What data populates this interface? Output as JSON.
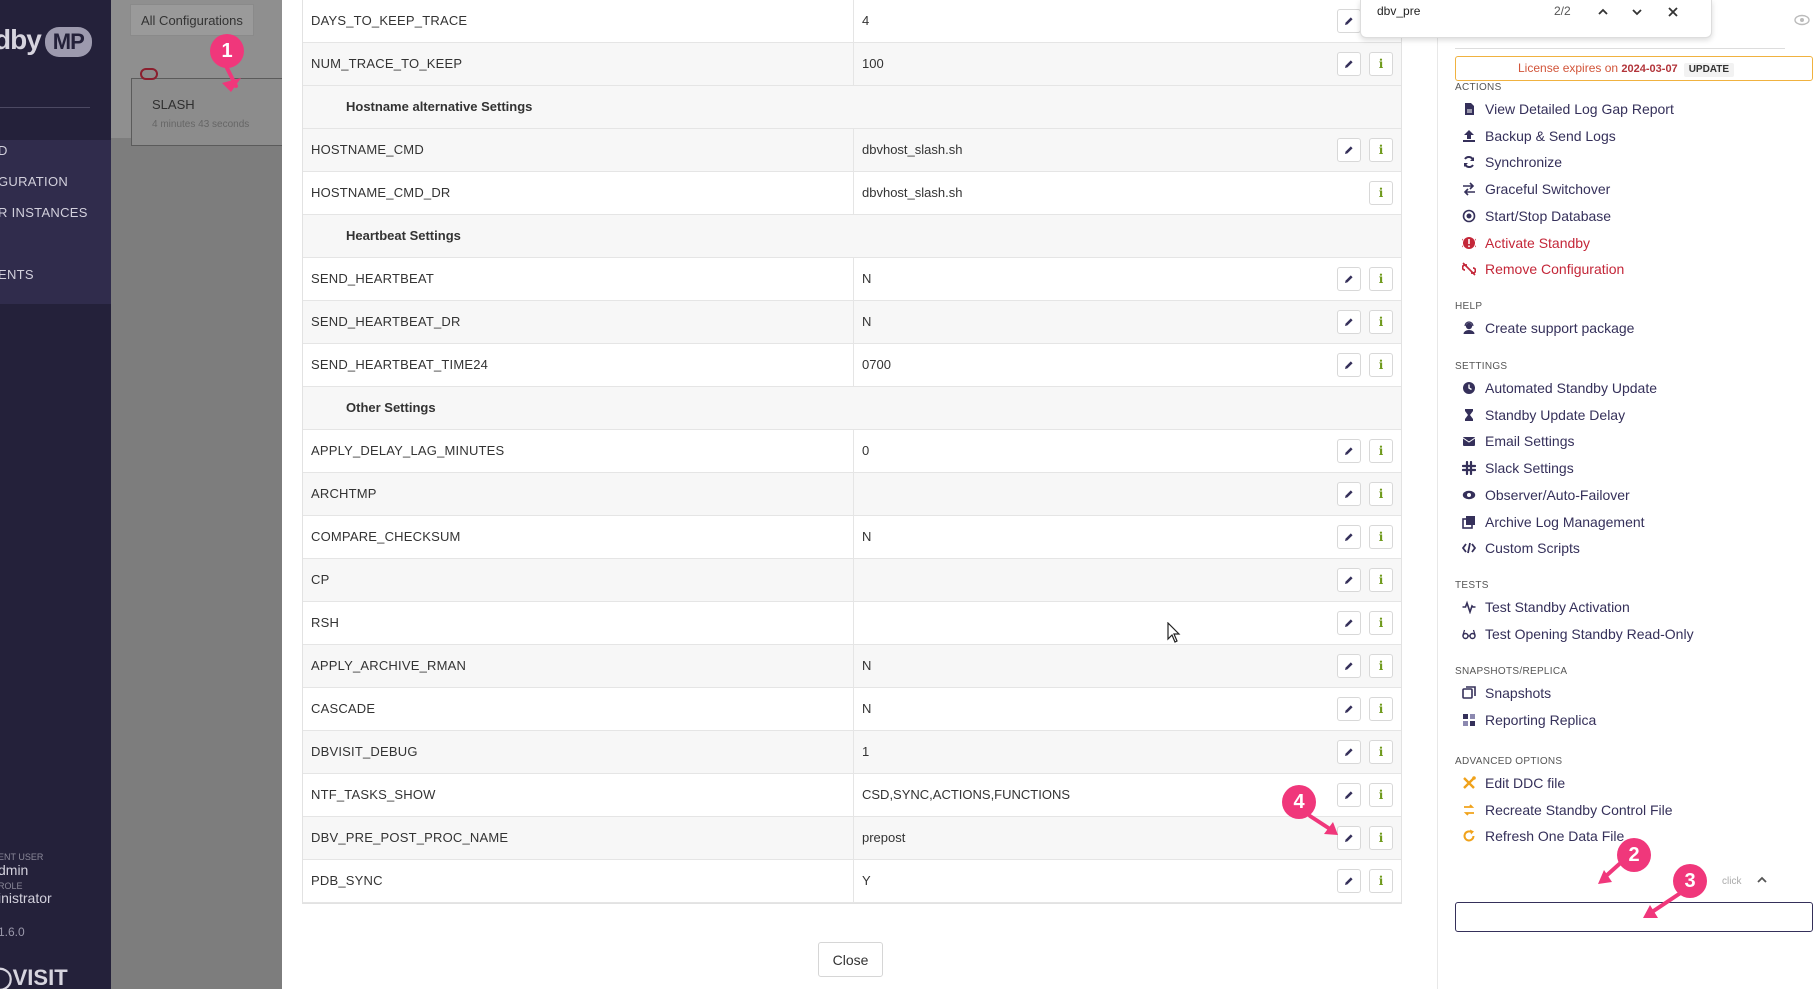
{
  "sidebar": {
    "logo_text": "dby",
    "logo_badge": "MP",
    "nav_items": [
      "D",
      "GURATION",
      "R INSTANCES",
      "ENTS"
    ],
    "user_label": "ENT USER",
    "user_name": "dmin",
    "role_label": "ROLE",
    "role_name": "inistrator",
    "version": "1.6.0",
    "brand": "VISIT"
  },
  "background": {
    "tab_label": "All Configurations",
    "card_name": "SLASH",
    "card_time": "4 minutes 43 seconds"
  },
  "find_bar": {
    "query": "dbv_pre",
    "count": "2/2"
  },
  "ddc_table": {
    "rows": [
      {
        "type": "param",
        "key": "DAYS_TO_KEEP_TRACE",
        "value": "4",
        "editable": true
      },
      {
        "type": "param",
        "key": "NUM_TRACE_TO_KEEP",
        "value": "100",
        "editable": true
      },
      {
        "type": "section",
        "title": "Hostname alternative Settings"
      },
      {
        "type": "param",
        "key": "HOSTNAME_CMD",
        "value": "dbvhost_slash.sh",
        "editable": true
      },
      {
        "type": "param",
        "key": "HOSTNAME_CMD_DR",
        "value": "dbvhost_slash.sh",
        "editable": false
      },
      {
        "type": "section",
        "title": "Heartbeat Settings"
      },
      {
        "type": "param",
        "key": "SEND_HEARTBEAT",
        "value": "N",
        "editable": true
      },
      {
        "type": "param",
        "key": "SEND_HEARTBEAT_DR",
        "value": "N",
        "editable": true
      },
      {
        "type": "param",
        "key": "SEND_HEARTBEAT_TIME24",
        "value": "0700",
        "editable": true
      },
      {
        "type": "section",
        "title": "Other Settings"
      },
      {
        "type": "param",
        "key": "APPLY_DELAY_LAG_MINUTES",
        "value": "0",
        "editable": true
      },
      {
        "type": "param",
        "key": "ARCHTMP",
        "value": "",
        "editable": true
      },
      {
        "type": "param",
        "key": "COMPARE_CHECKSUM",
        "value": "N",
        "editable": true
      },
      {
        "type": "param",
        "key": "CP",
        "value": "",
        "editable": true
      },
      {
        "type": "param",
        "key": "RSH",
        "value": "",
        "editable": true
      },
      {
        "type": "param",
        "key": "APPLY_ARCHIVE_RMAN",
        "value": "N",
        "editable": true
      },
      {
        "type": "param",
        "key": "CASCADE",
        "value": "N",
        "editable": true
      },
      {
        "type": "param",
        "key": "DBVISIT_DEBUG",
        "value": "1",
        "editable": true
      },
      {
        "type": "param",
        "key": "NTF_TASKS_SHOW",
        "value": "CSD,SYNC,ACTIONS,FUNCTIONS",
        "editable": true
      },
      {
        "type": "param",
        "key": "DBV_PRE_POST_PROC_NAME",
        "value": "prepost",
        "editable": true
      },
      {
        "type": "param",
        "key": "PDB_SYNC",
        "value": "Y",
        "editable": true
      }
    ],
    "info_glyph": "i"
  },
  "close_label": "Close",
  "right_panel": {
    "license_text": "License expires on",
    "license_date": "2024-03-07",
    "license_update": "UPDATE",
    "sections": [
      {
        "heading": "ACTIONS",
        "items": [
          {
            "label": "View Detailed Log Gap Report",
            "icon": "file-report-icon",
            "red": false
          },
          {
            "label": "Backup & Send Logs",
            "icon": "upload-icon",
            "red": false
          },
          {
            "label": "Synchronize",
            "icon": "sync-icon",
            "red": false
          },
          {
            "label": "Graceful Switchover",
            "icon": "switch-arrows-icon",
            "red": false
          },
          {
            "label": "Start/Stop Database",
            "icon": "dot-circle-icon",
            "red": false
          },
          {
            "label": "Activate Standby",
            "icon": "alert-circle-icon",
            "red": true
          },
          {
            "label": "Remove Configuration",
            "icon": "unlink-icon",
            "red": true
          }
        ]
      },
      {
        "heading": "HELP",
        "items": [
          {
            "label": "Create support package",
            "icon": "support-user-icon",
            "red": false
          }
        ]
      },
      {
        "heading": "SETTINGS",
        "items": [
          {
            "label": "Automated Standby Update",
            "icon": "clock-icon",
            "red": false
          },
          {
            "label": "Standby Update Delay",
            "icon": "hourglass-icon",
            "red": false
          },
          {
            "label": "Email Settings",
            "icon": "envelope-icon",
            "red": false
          },
          {
            "label": "Slack Settings",
            "icon": "slack-icon",
            "red": false
          },
          {
            "label": "Observer/Auto-Failover",
            "icon": "eye-icon",
            "red": false
          },
          {
            "label": "Archive Log Management",
            "icon": "archive-copy-icon",
            "red": false
          },
          {
            "label": "Custom Scripts",
            "icon": "code-icon",
            "red": false
          }
        ]
      },
      {
        "heading": "TESTS",
        "items": [
          {
            "label": "Test Standby Activation",
            "icon": "pulse-icon",
            "red": false
          },
          {
            "label": "Test Opening Standby Read-Only",
            "icon": "glasses-icon",
            "red": false
          }
        ]
      },
      {
        "heading": "SNAPSHOTS/REPLICA",
        "items": [
          {
            "label": "Snapshots",
            "icon": "snapshot-icon",
            "red": false
          },
          {
            "label": "Reporting Replica",
            "icon": "grid-icon",
            "red": false
          }
        ]
      },
      {
        "heading": "ADVANCED OPTIONS",
        "items": [
          {
            "label": "Edit DDC file",
            "icon": "tools-icon",
            "red": false
          },
          {
            "label": "Recreate Standby Control File",
            "icon": "recreate-icon",
            "red": false
          },
          {
            "label": "Refresh One Data File",
            "icon": "refresh-icon",
            "red": false
          }
        ]
      }
    ],
    "click_hint": "click"
  },
  "markers": [
    "1",
    "2",
    "3",
    "4"
  ],
  "colors": {
    "accent": "#35305a",
    "danger": "#c42739",
    "info": "#6f9a1c",
    "tools": "#f0a21b",
    "marker": "#f0377b"
  }
}
